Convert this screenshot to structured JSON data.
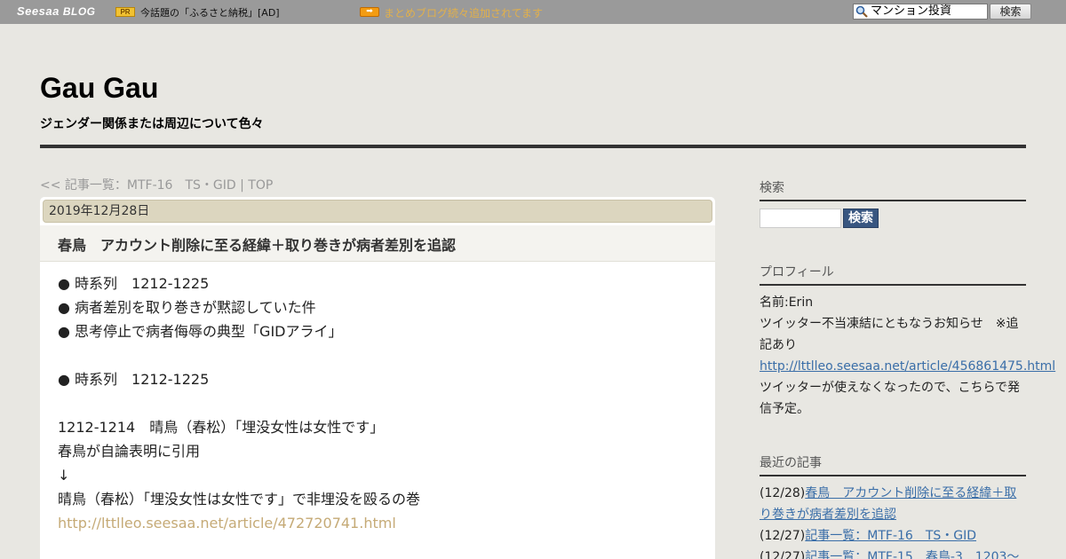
{
  "topbar": {
    "logo_main": "Seesaa",
    "logo_sub": "BLOG",
    "pr_badge": "PR",
    "pr_text": "今話題の「ふるさと納税」[AD]",
    "arrow_badge": "➡",
    "matome_text": "まとめブログ続々追加されてます",
    "search_value": "マンション投資",
    "search_button": "検索"
  },
  "header": {
    "site_title": "Gau Gau",
    "site_description": "ジェンダー関係または周辺について色々"
  },
  "breadcrumb": "<< 記事一覧：MTF-16　TS・GID | TOP",
  "post": {
    "date": "2019年12月28日",
    "title": "春鳥　アカウント削除に至る経緯＋取り巻きが病者差別を追認",
    "lines": [
      "● 時系列　1212-1225",
      "● 病者差別を取り巻きが黙認していた件",
      "● 思考停止で病者侮辱の典型「GIDアライ」",
      "",
      "● 時系列　1212-1225",
      "",
      "1212-1214　晴鳥（春松）「埋没女性は女性です」",
      "春鳥が自論表明に引用",
      "↓",
      "晴鳥（春松）「埋没女性は女性です」で非埋没を殴るの巻"
    ],
    "link": "http://lttlleo.seesaa.net/article/472720741.html"
  },
  "sidebar": {
    "search_heading": "検索",
    "search_button": "検索",
    "profile_heading": "プロフィール",
    "profile_name": "名前:Erin",
    "profile_notice": "ツイッター不当凍結にともなうお知らせ　※追記あり",
    "profile_link": "http://lttlleo.seesaa.net/article/456861475.html",
    "profile_note": "ツイッターが使えなくなったので、こちらで発信予定。",
    "recent_heading": "最近の記事",
    "recent": [
      {
        "date": "(12/28)",
        "title": "春鳥　アカウント削除に至る経緯＋取り巻きが病者差別を追認"
      },
      {
        "date": "(12/27)",
        "title": "記事一覧：MTF-16　TS・GID"
      },
      {
        "date": "(12/27)",
        "title": "記事一覧：MTF-15　春鳥-3　1203～"
      }
    ]
  }
}
